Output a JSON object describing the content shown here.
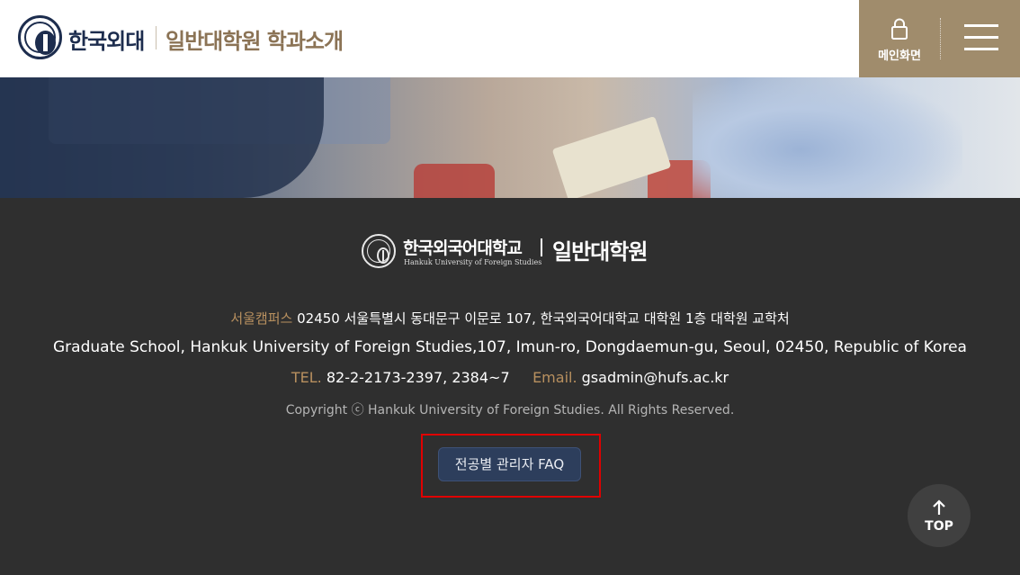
{
  "header": {
    "logo_text": "한국외대",
    "site_title": "일반대학원 학과소개",
    "main_link_label": "메인화면"
  },
  "footer": {
    "logo_kr": "한국외국어대학교",
    "logo_en": "Hankuk University of Foreign Studies",
    "logo_unit": "일반대학원",
    "campus_label": "서울캠퍼스",
    "address_kr": "02450 서울특별시 동대문구 이문로 107, 한국외국어대학교 대학원 1층 대학원 교학처",
    "address_en": "Graduate School, Hankuk University of Foreign Studies,107, Imun-ro, Dongdaemun-gu, Seoul, 02450, Republic of Korea",
    "tel_label": "TEL.",
    "tel_value": "82-2-2173-2397, 2384~7",
    "email_label": "Email.",
    "email_value": "gsadmin@hufs.ac.kr",
    "copyright": "Copyright ⓒ Hankuk University of Foreign Studies. All Rights Reserved.",
    "faq_button": "전공별 관리자 FAQ",
    "top_button": "TOP"
  },
  "colors": {
    "header_accent": "#a08c6c",
    "brand_navy": "#1d2d4e",
    "title_gold": "#8b7355",
    "footer_bg": "#2f2f2f",
    "footer_gold": "#b8905f",
    "faq_button_bg": "#2d3e5c",
    "highlight_red": "#e00000"
  },
  "icons": {
    "main_link": "lock-icon",
    "menu": "hamburger-menu-icon",
    "top": "arrow-up-icon"
  }
}
